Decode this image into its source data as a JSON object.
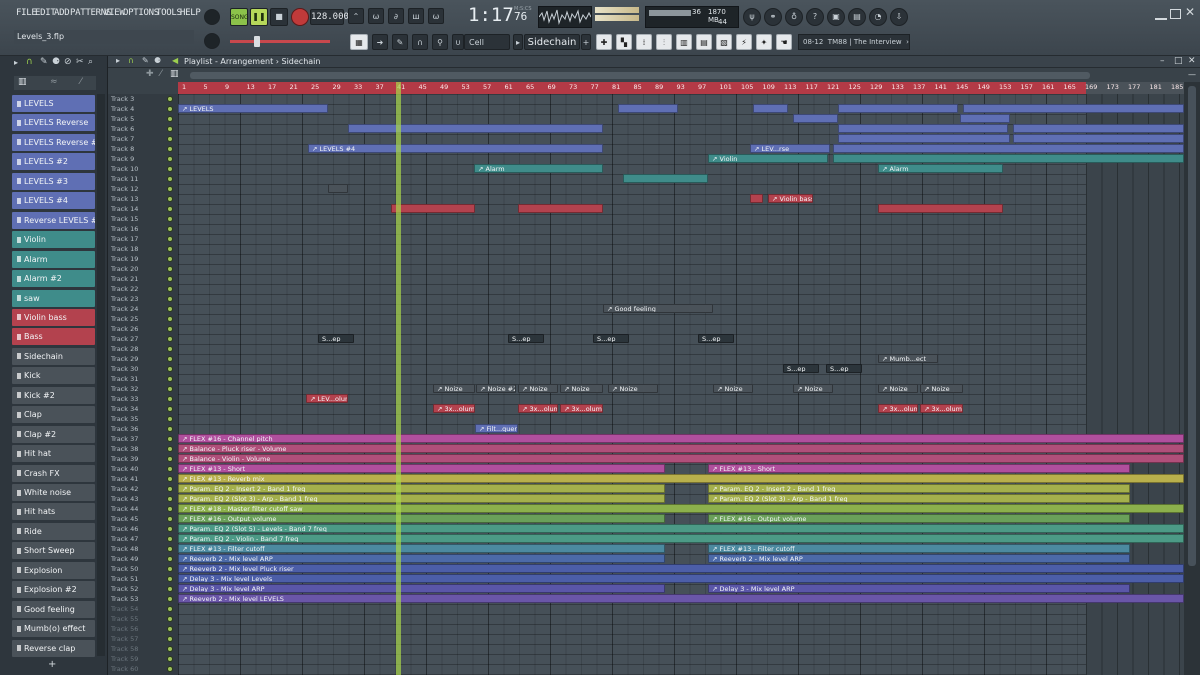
{
  "menu": [
    "FILE",
    "EDIT",
    "ADD",
    "PATTERNS",
    "VIEW",
    "OPTIONS",
    "TOOLS",
    "HELP"
  ],
  "transport": {
    "mode_label": "SONG",
    "tempo": "128.000",
    "time": "1:17",
    "time_small": "76",
    "time_unit": "M:S:CS"
  },
  "project": {
    "file": "Levels_3.flp"
  },
  "resources": {
    "cpu": "36",
    "mem": "1870 MB",
    "poly": "44"
  },
  "snap": {
    "value": "Cell"
  },
  "pattern_selector": {
    "value": "Sidechain"
  },
  "news": {
    "date": "08-12",
    "text": "TM88 | The Interview"
  },
  "playlist": {
    "breadcrumb": "Playlist - Arrangement › Sidechain"
  },
  "ruler_ticks": [
    "1",
    "5",
    "9",
    "13",
    "17",
    "21",
    "25",
    "29",
    "33",
    "37",
    "41",
    "45",
    "49",
    "53",
    "57",
    "61",
    "65",
    "69",
    "73",
    "77",
    "81",
    "85",
    "89",
    "93",
    "97",
    "101",
    "105",
    "109",
    "113",
    "117",
    "121",
    "125",
    "129",
    "133",
    "137",
    "141",
    "145",
    "149",
    "153",
    "157",
    "161",
    "165",
    "169",
    "173",
    "177",
    "181",
    "185",
    "189"
  ],
  "patterns": [
    {
      "name": "LEVELS",
      "color": "#5f6fb4"
    },
    {
      "name": "LEVELS Reverse",
      "color": "#5f6fb4"
    },
    {
      "name": "LEVELS Reverse #2",
      "color": "#5f6fb4"
    },
    {
      "name": "LEVELS #2",
      "color": "#5f6fb4"
    },
    {
      "name": "LEVELS #3",
      "color": "#5f6fb4"
    },
    {
      "name": "LEVELS #4",
      "color": "#5f6fb4"
    },
    {
      "name": "Reverse LEVELS #2",
      "color": "#5f6fb4"
    },
    {
      "name": "Violin",
      "color": "#3f8c8a"
    },
    {
      "name": "Alarm",
      "color": "#3f8c8a"
    },
    {
      "name": "Alarm #2",
      "color": "#3f8c8a"
    },
    {
      "name": "saw",
      "color": "#3f8c8a"
    },
    {
      "name": "Violin bass",
      "color": "#b3424e"
    },
    {
      "name": "Bass",
      "color": "#b3424e"
    },
    {
      "name": "Sidechain",
      "color": "#4a5259"
    },
    {
      "name": "Kick",
      "color": "#4a5259"
    },
    {
      "name": "Kick #2",
      "color": "#4a5259"
    },
    {
      "name": "Clap",
      "color": "#4a5259"
    },
    {
      "name": "Clap #2",
      "color": "#4a5259"
    },
    {
      "name": "Hit hat",
      "color": "#4a5259"
    },
    {
      "name": "Crash FX",
      "color": "#4a5259"
    },
    {
      "name": "White noise",
      "color": "#4a5259"
    },
    {
      "name": "Hit hats",
      "color": "#4a5259"
    },
    {
      "name": "Ride",
      "color": "#4a5259"
    },
    {
      "name": "Short Sweep",
      "color": "#4a5259"
    },
    {
      "name": "Explosion",
      "color": "#4a5259"
    },
    {
      "name": "Explosion #2",
      "color": "#4a5259"
    },
    {
      "name": "Good feeling",
      "color": "#4a5259"
    },
    {
      "name": "Mumb(o) effect",
      "color": "#4a5259"
    },
    {
      "name": "Reverse clap",
      "color": "#4a5259"
    }
  ],
  "track_start": 3,
  "track_count": 58,
  "clips": [
    {
      "t": 4,
      "s": 0,
      "e": 150,
      "c": "#5f6fb4",
      "l": "LEVELS"
    },
    {
      "t": 4,
      "s": 440,
      "e": 500,
      "c": "#5f6fb4",
      "l": ""
    },
    {
      "t": 4,
      "s": 575,
      "e": 610,
      "c": "#5f6fb4",
      "l": ""
    },
    {
      "t": 4,
      "s": 660,
      "e": 780,
      "c": "#5f6fb4",
      "l": ""
    },
    {
      "t": 4,
      "s": 785,
      "e": 1006,
      "c": "#5f6fb4",
      "l": ""
    },
    {
      "t": 5,
      "s": 615,
      "e": 660,
      "c": "#5f6fb4",
      "l": ""
    },
    {
      "t": 5,
      "s": 782,
      "e": 832,
      "c": "#5f6fb4",
      "l": ""
    },
    {
      "t": 6,
      "s": 170,
      "e": 425,
      "c": "#5f6fb4",
      "l": ""
    },
    {
      "t": 6,
      "s": 660,
      "e": 830,
      "c": "#5f6fb4",
      "l": ""
    },
    {
      "t": 6,
      "s": 835,
      "e": 1006,
      "c": "#5f6fb4",
      "l": ""
    },
    {
      "t": 7,
      "s": 660,
      "e": 832,
      "c": "#5f6fb4",
      "l": ""
    },
    {
      "t": 7,
      "s": 835,
      "e": 1006,
      "c": "#5f6fb4",
      "l": ""
    },
    {
      "t": 8,
      "s": 130,
      "e": 425,
      "c": "#5f6fb4",
      "l": "LEVELS #4"
    },
    {
      "t": 8,
      "s": 572,
      "e": 652,
      "c": "#5f6fb4",
      "l": "LEV...rse"
    },
    {
      "t": 8,
      "s": 655,
      "e": 1006,
      "c": "#5f6fb4",
      "l": ""
    },
    {
      "t": 9,
      "s": 530,
      "e": 650,
      "c": "#3f8c8a",
      "l": "Violin"
    },
    {
      "t": 9,
      "s": 655,
      "e": 1006,
      "c": "#3f8c8a",
      "l": ""
    },
    {
      "t": 10,
      "s": 296,
      "e": 425,
      "c": "#3f8c8a",
      "l": "Alarm"
    },
    {
      "t": 10,
      "s": 700,
      "e": 825,
      "c": "#3f8c8a",
      "l": "Alarm"
    },
    {
      "t": 11,
      "s": 445,
      "e": 530,
      "c": "#3f8c8a",
      "l": ""
    },
    {
      "t": 12,
      "s": 150,
      "e": 170,
      "c": "#4a5259",
      "l": ""
    },
    {
      "t": 13,
      "s": 572,
      "e": 585,
      "c": "#b3424e",
      "l": ""
    },
    {
      "t": 13,
      "s": 590,
      "e": 635,
      "c": "#b3424e",
      "l": "Violin bass"
    },
    {
      "t": 14,
      "s": 213,
      "e": 297,
      "c": "#b3424e",
      "l": ""
    },
    {
      "t": 14,
      "s": 340,
      "e": 425,
      "c": "#b3424e",
      "l": ""
    },
    {
      "t": 14,
      "s": 700,
      "e": 825,
      "c": "#b3424e",
      "l": ""
    },
    {
      "t": 24,
      "s": 425,
      "e": 535,
      "c": "#4a5259",
      "l": "Good feeling"
    },
    {
      "t": 29,
      "s": 700,
      "e": 760,
      "c": "#4a5259",
      "l": "Mumb...ect"
    },
    {
      "t": 32,
      "s": 255,
      "e": 297,
      "c": "#4a5259",
      "l": "Noize"
    },
    {
      "t": 32,
      "s": 298,
      "e": 338,
      "c": "#4a5259",
      "l": "Noize #2"
    },
    {
      "t": 32,
      "s": 340,
      "e": 380,
      "c": "#4a5259",
      "l": "Noize"
    },
    {
      "t": 32,
      "s": 382,
      "e": 425,
      "c": "#4a5259",
      "l": "Noize"
    },
    {
      "t": 32,
      "s": 430,
      "e": 480,
      "c": "#4a5259",
      "l": "Noize"
    },
    {
      "t": 32,
      "s": 535,
      "e": 575,
      "c": "#4a5259",
      "l": "Noize"
    },
    {
      "t": 32,
      "s": 615,
      "e": 655,
      "c": "#4a5259",
      "l": "Noize"
    },
    {
      "t": 32,
      "s": 700,
      "e": 740,
      "c": "#4a5259",
      "l": "Noize"
    },
    {
      "t": 32,
      "s": 742,
      "e": 785,
      "c": "#4a5259",
      "l": "Noize"
    },
    {
      "t": 33,
      "s": 128,
      "e": 170,
      "c": "#b3424e",
      "l": "LEV...olume"
    },
    {
      "t": 34,
      "s": 255,
      "e": 297,
      "c": "#b3424e",
      "l": "3x...olume"
    },
    {
      "t": 34,
      "s": 340,
      "e": 380,
      "c": "#b3424e",
      "l": "3x...olume"
    },
    {
      "t": 34,
      "s": 382,
      "e": 425,
      "c": "#b3424e",
      "l": "3x...olume"
    },
    {
      "t": 34,
      "s": 700,
      "e": 740,
      "c": "#b3424e",
      "l": "3x...olume"
    },
    {
      "t": 34,
      "s": 742,
      "e": 785,
      "c": "#b3424e",
      "l": "3x...olume"
    },
    {
      "t": 36,
      "s": 297,
      "e": 340,
      "c": "#5f6fb4",
      "l": "Filt...quency"
    },
    {
      "t": 37,
      "s": 0,
      "e": 1006,
      "c": "#b04f9d",
      "l": "FLEX #16 - Channel pitch"
    },
    {
      "t": 38,
      "s": 0,
      "e": 1006,
      "c": "#b04f7a",
      "l": "Balance - Pluck riser - Volume"
    },
    {
      "t": 39,
      "s": 0,
      "e": 1006,
      "c": "#b04f7a",
      "l": "Balance - Violin - Volume"
    },
    {
      "t": 40,
      "s": 0,
      "e": 487,
      "c": "#b04f9d",
      "l": "FLEX #13 - Short"
    },
    {
      "t": 40,
      "s": 530,
      "e": 952,
      "c": "#b04f9d",
      "l": "FLEX #13 - Short"
    },
    {
      "t": 41,
      "s": 0,
      "e": 1006,
      "c": "#b8b04c",
      "l": "FLEX #13 - Reverb mix"
    },
    {
      "t": 42,
      "s": 0,
      "e": 487,
      "c": "#a4b04c",
      "l": "Param. EQ 2 - Insert 2 - Band 1 freq"
    },
    {
      "t": 42,
      "s": 530,
      "e": 952,
      "c": "#a4b04c",
      "l": "Param. EQ 2 - Insert 2 - Band 1 freq"
    },
    {
      "t": 43,
      "s": 0,
      "e": 487,
      "c": "#a4b04c",
      "l": "Param. EQ 2 (Slot 3) - Arp - Band 1 freq"
    },
    {
      "t": 43,
      "s": 530,
      "e": 952,
      "c": "#a4b04c",
      "l": "Param. EQ 2 (Slot 3) - Arp - Band 1 freq"
    },
    {
      "t": 44,
      "s": 0,
      "e": 1006,
      "c": "#8cb04c",
      "l": "FLEX #18 - Master filter cutoff saw"
    },
    {
      "t": 45,
      "s": 0,
      "e": 487,
      "c": "#6aa05a",
      "l": "FLEX #16 - Output volume"
    },
    {
      "t": 45,
      "s": 530,
      "e": 952,
      "c": "#6aa05a",
      "l": "FLEX #16 - Output volume"
    },
    {
      "t": 46,
      "s": 0,
      "e": 1006,
      "c": "#4c9a86",
      "l": "Param. EQ 2 (Slot 5) - Levels - Band 7 freq"
    },
    {
      "t": 47,
      "s": 0,
      "e": 1006,
      "c": "#4c9a86",
      "l": "Param. EQ 2 - Violin - Band 7 freq"
    },
    {
      "t": 48,
      "s": 0,
      "e": 487,
      "c": "#4c8aa0",
      "l": "FLEX #13 - Filter cutoff"
    },
    {
      "t": 48,
      "s": 530,
      "e": 952,
      "c": "#4c8aa0",
      "l": "FLEX #13 - Filter cutoff"
    },
    {
      "t": 49,
      "s": 0,
      "e": 487,
      "c": "#4c6aa8",
      "l": "Reeverb 2 - Mix level ARP"
    },
    {
      "t": 49,
      "s": 530,
      "e": 952,
      "c": "#4c6aa8",
      "l": "Reeverb 2 - Mix level ARP"
    },
    {
      "t": 50,
      "s": 0,
      "e": 1006,
      "c": "#4c5ea8",
      "l": "Reeverb 2 - Mix level Pluck riser"
    },
    {
      "t": 51,
      "s": 0,
      "e": 1006,
      "c": "#4c5ea8",
      "l": "Delay 3 - Mix level Levels"
    },
    {
      "t": 52,
      "s": 0,
      "e": 487,
      "c": "#5a56a8",
      "l": "Delay 3 - Mix level ARP"
    },
    {
      "t": 52,
      "s": 530,
      "e": 952,
      "c": "#5a56a8",
      "l": "Delay 3 - Mix level ARP"
    },
    {
      "t": 53,
      "s": 0,
      "e": 1006,
      "c": "#6a56a8",
      "l": "Reeverb 2 - Mix level LEVELS"
    }
  ],
  "small_labels": [
    {
      "t": 27,
      "s": 140,
      "l": "S...ep"
    },
    {
      "t": 27,
      "s": 330,
      "l": "S...ep"
    },
    {
      "t": 27,
      "s": 415,
      "l": "S...ep"
    },
    {
      "t": 27,
      "s": 520,
      "l": "S...ep"
    },
    {
      "t": 30,
      "s": 605,
      "l": "S...ep"
    },
    {
      "t": 30,
      "s": 648,
      "l": "S...ep"
    }
  ]
}
